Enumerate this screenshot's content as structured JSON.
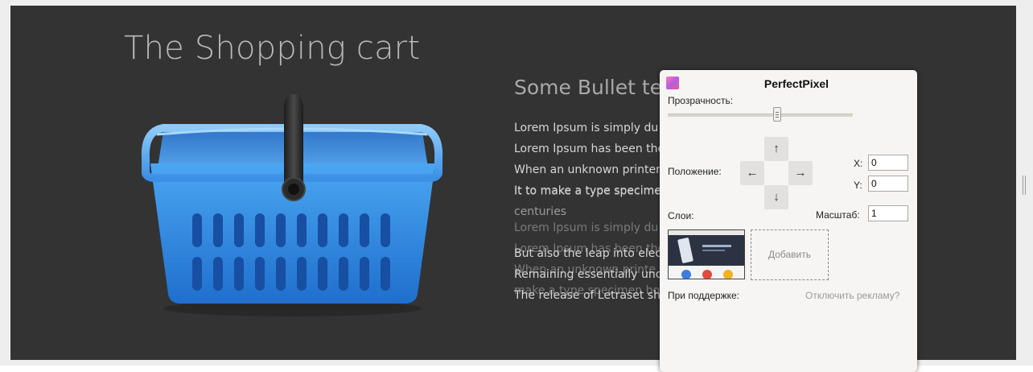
{
  "hero": {
    "title": "The Shopping cart",
    "bullet_heading": "Some Bullet tex",
    "lines": [
      "Lorem Ipsum is simply du",
      "Lorem Ipsum has been the",
      "When an unknown printer",
      "It to make a type specimen",
      "centuries",
      "But also the leap into elec",
      "Remaining essentially unc",
      "The release of Letraset sh"
    ],
    "ghost_lines": [
      "It to make a type specimen",
      "Lorem Ipsum is simply du",
      "Lorem Ipsum has been the",
      "When an unknown printe",
      "make a type specimen bo"
    ]
  },
  "panel": {
    "title": "PerfectPixel",
    "opacity_label": "Прозрачность:",
    "opacity_value": 0.59,
    "position_label": "Положение:",
    "arrows": {
      "up": "↑",
      "left": "←",
      "right": "→",
      "down": "↓"
    },
    "x_label": "X:",
    "x_value": "0",
    "y_label": "Y:",
    "y_value": "0",
    "layers_label": "Слои:",
    "scale_label": "Масштаб:",
    "scale_value": "1",
    "add_label": "Добавить",
    "support_label": "При поддержке:",
    "disable_ads_label": "Отключить рекламу?"
  },
  "colors": {
    "hero_bg": "#333333",
    "panel_bg": "#f6f5f3",
    "basket_blue": "#2f86e0",
    "handle": "#2a2a2a"
  }
}
